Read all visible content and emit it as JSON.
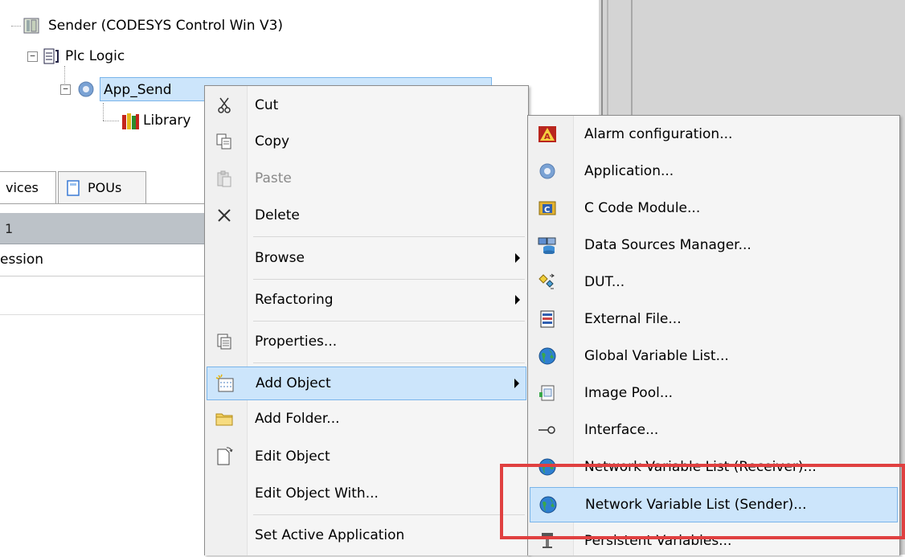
{
  "tree": {
    "device": "Sender (CODESYS Control Win V3)",
    "plc_logic": "Plc Logic",
    "application": "App_Send",
    "library": "Library"
  },
  "tabs": [
    {
      "label": "vices"
    },
    {
      "label": "POUs"
    }
  ],
  "grid": {
    "header": "1",
    "row1": "ession"
  },
  "context_menu": {
    "items": [
      {
        "label": "Cut",
        "icon": "scissors-icon"
      },
      {
        "label": "Copy",
        "icon": "copy-icon"
      },
      {
        "label": "Paste",
        "icon": "paste-icon",
        "disabled": true
      },
      {
        "label": "Delete",
        "icon": "delete-x-icon"
      },
      {
        "label": "Browse",
        "submenu": true
      },
      {
        "label": "Refactoring",
        "submenu": true
      },
      {
        "label": "Properties...",
        "icon": "properties-icon"
      },
      {
        "label": "Add Object",
        "icon": "add-object-icon",
        "submenu": true,
        "highlighted": true
      },
      {
        "label": "Add Folder...",
        "icon": "folder-icon"
      },
      {
        "label": "Edit Object",
        "icon": "edit-object-icon"
      },
      {
        "label": "Edit Object With..."
      },
      {
        "label": "Set Active Application"
      }
    ]
  },
  "submenu": {
    "items": [
      {
        "label": "Alarm configuration...",
        "icon": "alarm-icon"
      },
      {
        "label": "Application...",
        "icon": "gear-icon"
      },
      {
        "label": "C Code Module...",
        "icon": "c-code-icon"
      },
      {
        "label": "Data Sources Manager...",
        "icon": "data-sources-icon"
      },
      {
        "label": "DUT...",
        "icon": "dut-icon"
      },
      {
        "label": "External File...",
        "icon": "external-file-icon"
      },
      {
        "label": "Global Variable List...",
        "icon": "globe-icon"
      },
      {
        "label": "Image Pool...",
        "icon": "image-pool-icon"
      },
      {
        "label": "Interface...",
        "icon": "interface-icon"
      },
      {
        "label": "Network Variable List (Receiver)...",
        "icon": "globe-icon"
      },
      {
        "label": "Network Variable List (Sender)...",
        "icon": "globe-icon",
        "highlighted": true
      },
      {
        "label": "Persistent Variables...",
        "icon": "persistent-icon"
      }
    ]
  },
  "colors": {
    "highlight_bg": "#cce5fb",
    "highlight_border": "#79b4ea",
    "annotation_red": "#e04040"
  }
}
